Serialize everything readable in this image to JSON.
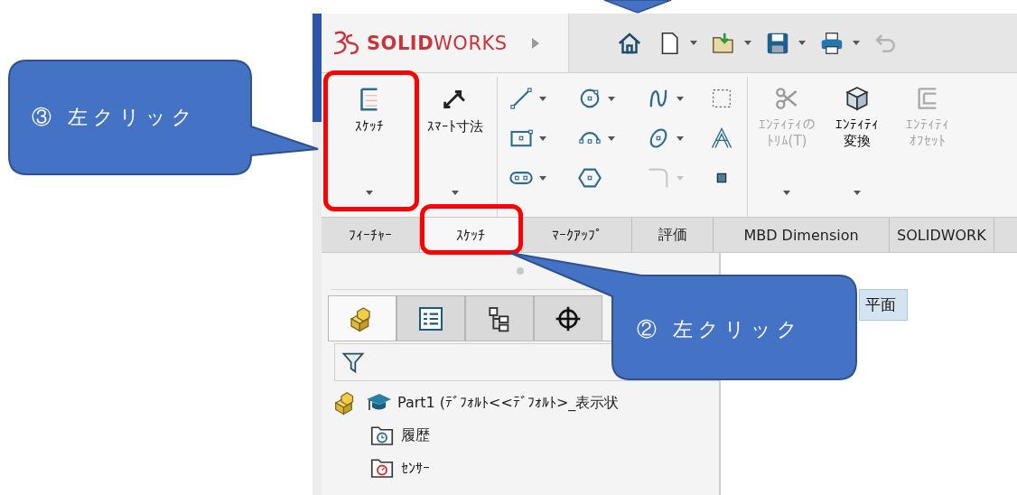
{
  "callouts": [
    {
      "text": "③ 左クリック"
    },
    {
      "text": "② 左クリック"
    }
  ],
  "app": {
    "logo": "**SOLID**WORKS"
  },
  "quick_access": [
    {
      "kind": "home",
      "dropdown": false,
      "disabled": false
    },
    {
      "kind": "new",
      "dropdown": true,
      "disabled": false
    },
    {
      "kind": "open",
      "dropdown": true,
      "disabled": false
    },
    {
      "kind": "save",
      "dropdown": true,
      "disabled": false
    },
    {
      "kind": "print",
      "dropdown": true,
      "disabled": false
    },
    {
      "kind": "undo",
      "dropdown": false,
      "disabled": true
    }
  ],
  "ribbon": {
    "large_tools": [
      {
        "kind": "sketch",
        "label": "ｽｹｯﾁ",
        "dropdown": true,
        "disabled": false
      },
      {
        "kind": "smart_dimension",
        "label": "ｽﾏｰﾄ寸法",
        "dropdown": true,
        "disabled": false
      }
    ],
    "small_tools": [
      {
        "kind": "line",
        "dropdown": true,
        "disabled": false
      },
      {
        "kind": "circle",
        "dropdown": true,
        "disabled": false
      },
      {
        "kind": "spline",
        "dropdown": true,
        "disabled": false
      },
      {
        "kind": "construction",
        "dropdown": false,
        "disabled": false
      },
      {
        "kind": "rectangle",
        "dropdown": true,
        "disabled": false
      },
      {
        "kind": "arc",
        "dropdown": true,
        "disabled": false
      },
      {
        "kind": "ellipse",
        "dropdown": true,
        "disabled": false
      },
      {
        "kind": "text",
        "dropdown": false,
        "disabled": false
      },
      {
        "kind": "slot",
        "dropdown": true,
        "disabled": false
      },
      {
        "kind": "polygon",
        "dropdown": false,
        "disabled": false
      },
      {
        "kind": "fillet",
        "dropdown": true,
        "disabled": true
      },
      {
        "kind": "point",
        "dropdown": false,
        "disabled": false
      }
    ],
    "entity_tools": [
      {
        "kind": "trim",
        "label_lines": [
          "ｴﾝﾃｨﾃｨの",
          "ﾄﾘﾑ(T)"
        ],
        "dropdown": true,
        "disabled": true
      },
      {
        "kind": "convert",
        "label_lines": [
          "ｴﾝﾃｨﾃｨ",
          "変換"
        ],
        "dropdown": true,
        "disabled": false
      },
      {
        "kind": "offset",
        "label_lines": [
          "ｴﾝﾃｨﾃｨ",
          "ｵﾌｾｯﾄ"
        ],
        "dropdown": false,
        "disabled": true
      }
    ]
  },
  "tabs": [
    {
      "label": "ﾌｨｰﾁｬｰ",
      "selected": false
    },
    {
      "label": "ｽｹｯﾁ",
      "selected": true
    },
    {
      "label": "ﾏｰｸｱｯﾌﾟ",
      "selected": false
    },
    {
      "label": "評価",
      "selected": false
    },
    {
      "label": "MBD Dimension",
      "selected": false
    },
    {
      "label": "SOLIDWORK",
      "selected": false
    }
  ],
  "feature_manager": {
    "panel_tabs": [
      {
        "kind": "part",
        "selected": true
      },
      {
        "kind": "property",
        "selected": false
      },
      {
        "kind": "config",
        "selected": false
      },
      {
        "kind": "target",
        "selected": false
      }
    ],
    "tree": [
      {
        "kind": "part",
        "label": "Part1 (ﾃﾞﾌｫﾙﾄ<<ﾃﾞﾌｫﾙﾄ>_表示状",
        "children": [
          {
            "kind": "history",
            "label": "履歴"
          },
          {
            "kind": "sensor",
            "label": "ｾﾝｻｰ"
          }
        ]
      }
    ]
  },
  "canvas": {
    "plane_label": "平面"
  }
}
